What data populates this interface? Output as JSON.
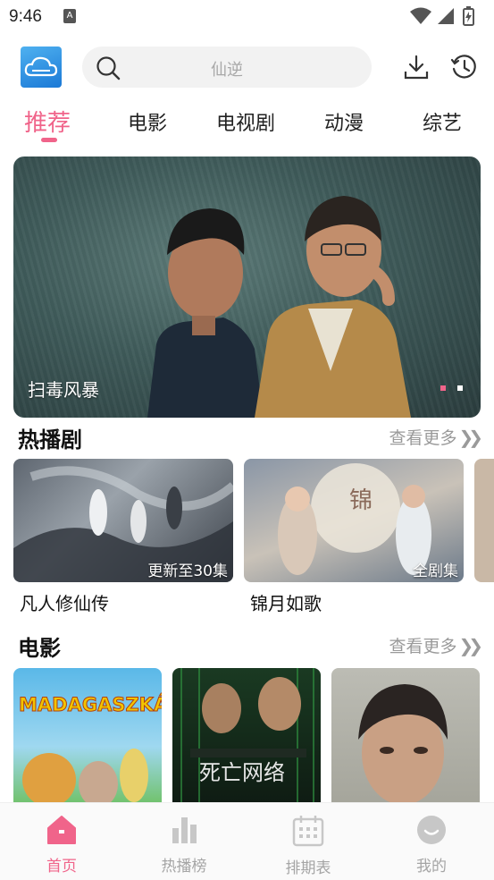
{
  "status_bar": {
    "time": "9:46",
    "notification_letter": "A"
  },
  "header": {
    "logo_icon": "cloud-logo-icon",
    "search_placeholder": "仙逆",
    "download_icon": "download-icon",
    "history_icon": "history-clock-icon"
  },
  "tabs": [
    {
      "label": "推荐",
      "active": true
    },
    {
      "label": "电影",
      "active": false
    },
    {
      "label": "电视剧",
      "active": false
    },
    {
      "label": "动漫",
      "active": false
    },
    {
      "label": "综艺",
      "active": false
    }
  ],
  "banner": {
    "title": "扫毒风暴",
    "pages": 2,
    "current_page": 1
  },
  "hot_series": {
    "title": "热播剧",
    "more": "查看更多",
    "items": [
      {
        "title": "凡人修仙传",
        "badge": "更新至30集"
      },
      {
        "title": "锦月如歌",
        "badge": "全剧集"
      }
    ]
  },
  "movies": {
    "title": "电影",
    "more": "查看更多",
    "items": [
      {
        "poster_text": "MADAGASZKÁR"
      },
      {
        "poster_text": "死亡网络"
      },
      {
        "poster_text": ""
      }
    ]
  },
  "bottom_nav": [
    {
      "label": "首页",
      "icon": "home-icon",
      "active": true
    },
    {
      "label": "热播榜",
      "icon": "bar-chart-icon",
      "active": false
    },
    {
      "label": "排期表",
      "icon": "calendar-icon",
      "active": false
    },
    {
      "label": "我的",
      "icon": "profile-smile-icon",
      "active": false
    }
  ],
  "colors": {
    "accent": "#f0648a",
    "inactive": "#a5a5a5"
  }
}
